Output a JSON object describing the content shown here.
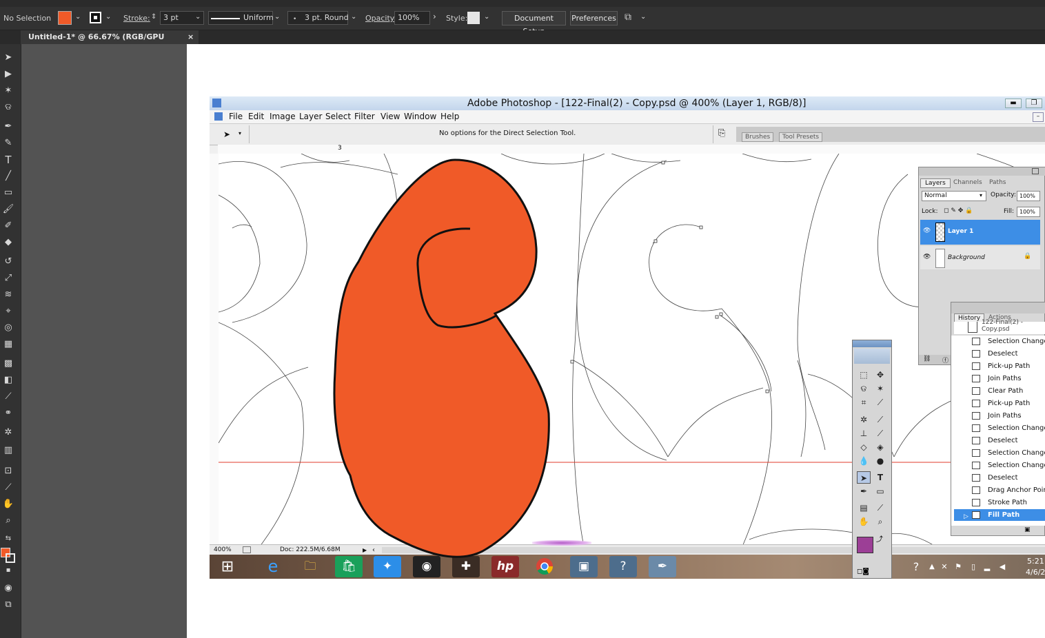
{
  "illustrator": {
    "control_bar": {
      "selection": "No Selection",
      "fill_color": "#f05a28",
      "stroke_label": "Stroke:",
      "stroke_value": "3 pt",
      "profile": "Uniform",
      "brush": "3 pt. Round",
      "opacity_label": "Opacity:",
      "opacity_value": "100%",
      "style_label": "Style:",
      "document_setup": "Document Setup",
      "preferences": "Preferences"
    },
    "doc_tab": {
      "title": "Untitled-1* @ 66.67% (RGB/GPU Preview)",
      "close": "×"
    },
    "tools": [
      "selection-tool",
      "direct-selection-tool",
      "magic-wand-tool",
      "lasso-tool",
      "pen-tool",
      "curvature-tool",
      "type-tool",
      "line-tool",
      "rectangle-tool",
      "paintbrush-tool",
      "shaper-tool",
      "eraser-tool",
      "rotate-tool",
      "scale-tool",
      "warp-tool",
      "free-transform-tool",
      "shape-builder-tool",
      "perspective-tool",
      "mesh-tool",
      "gradient-tool",
      "eyedropper-tool",
      "blend-tool",
      "symbol-sprayer-tool",
      "column-graph-tool",
      "artboard-tool",
      "slice-tool",
      "hand-tool",
      "zoom-tool"
    ]
  },
  "photoshop": {
    "title": "Adobe Photoshop - [122-Final(2) - Copy.psd @ 400% (Layer 1, RGB/8)]",
    "menu": [
      "File",
      "Edit",
      "Image",
      "Layer",
      "Select",
      "Filter",
      "View",
      "Window",
      "Help"
    ],
    "options_text": "No options for the Direct Selection Tool.",
    "dock_tabs": [
      "Brushes",
      "Tool Presets"
    ],
    "ruler_mark": "3",
    "status": {
      "zoom": "400%",
      "doc": "Doc: 222.5M/6.68M"
    },
    "layers_panel": {
      "tabs": [
        "Layers",
        "Channels",
        "Paths"
      ],
      "blend_mode": "Normal",
      "opacity_label": "Opacity:",
      "opacity_value": "100%",
      "lock_label": "Lock:",
      "fill_label": "Fill:",
      "fill_value": "100%",
      "layers": [
        {
          "name": "Layer 1",
          "selected": true
        },
        {
          "name": "Background",
          "selected": false
        }
      ]
    },
    "history_panel": {
      "tabs": [
        "History",
        "Actions"
      ],
      "snapshot": "122-Final(2) - Copy.psd",
      "items": [
        "Selection Change",
        "Deselect",
        "Pick-up Path",
        "Join Paths",
        "Clear Path",
        "Pick-up Path",
        "Join Paths",
        "Selection Change",
        "Deselect",
        "Selection Change",
        "Selection Change",
        "Deselect",
        "Drag Anchor Point",
        "Stroke Path",
        "Fill Path"
      ]
    },
    "foreground_color": "#9c3f96",
    "taskbar": {
      "time": "5:21",
      "date": "4/6/2"
    }
  },
  "shape_fill": "#f05a28"
}
